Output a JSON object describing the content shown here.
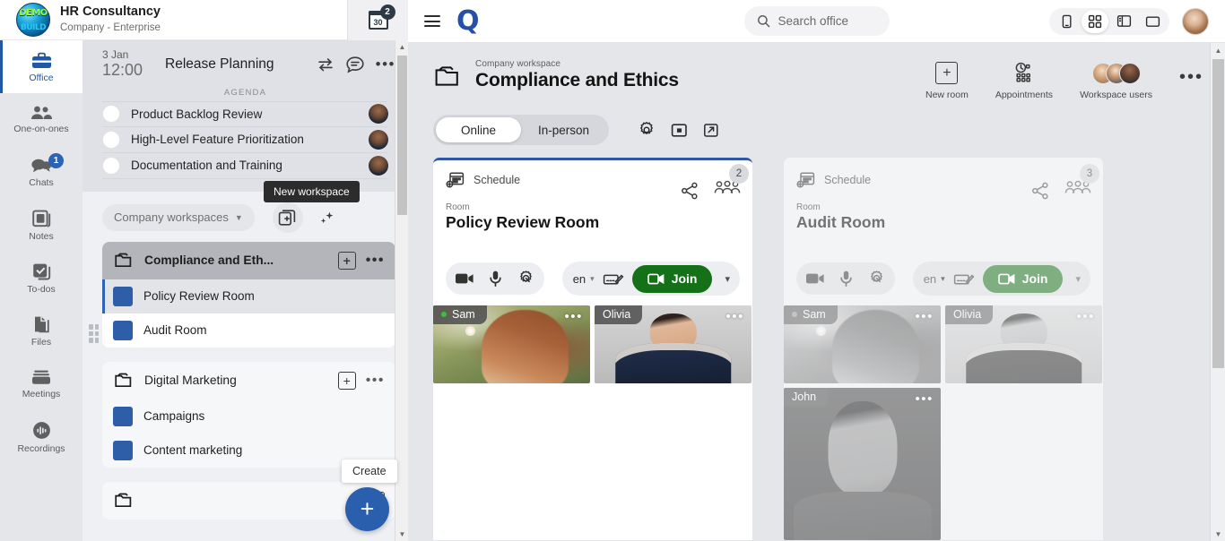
{
  "brand": {
    "title": "HR Consultancy",
    "subtitle": "Company - Enterprise",
    "logo_text_top": "DEMO",
    "logo_text_bottom": "BUILD",
    "calendar_day": "30",
    "calendar_badge": "2"
  },
  "rail": {
    "items": [
      {
        "label": "Office",
        "icon": "briefcase-icon",
        "active": true,
        "badge": ""
      },
      {
        "label": "One-on-ones",
        "icon": "people-icon",
        "active": false,
        "badge": ""
      },
      {
        "label": "Chats",
        "icon": "chat-bubbles-icon",
        "active": false,
        "badge": "1"
      },
      {
        "label": "Notes",
        "icon": "notes-icon",
        "active": false,
        "badge": ""
      },
      {
        "label": "To-dos",
        "icon": "checkbox-stack-icon",
        "active": false,
        "badge": ""
      },
      {
        "label": "Files",
        "icon": "files-icon",
        "active": false,
        "badge": ""
      },
      {
        "label": "Meetings",
        "icon": "meetings-icon",
        "active": false,
        "badge": ""
      },
      {
        "label": "Recordings",
        "icon": "recordings-icon",
        "active": false,
        "badge": ""
      }
    ]
  },
  "agenda": {
    "date": "3 Jan",
    "time": "12:00",
    "title": "Release Planning",
    "section_label": "AGENDA",
    "items": [
      {
        "text": "Product Backlog Review"
      },
      {
        "text": "High-Level Feature Prioritization"
      },
      {
        "text": "Documentation and Training"
      }
    ]
  },
  "workspaces_panel": {
    "selector_label": "Company workspaces",
    "new_workspace_tooltip": "New workspace",
    "create_tooltip": "Create",
    "groups": [
      {
        "name": "Compliance and Eth...",
        "selected": true,
        "rooms": [
          {
            "name": "Policy Review Room",
            "active": true
          },
          {
            "name": "Audit Room",
            "active": false
          }
        ]
      },
      {
        "name": "Digital Marketing",
        "selected": false,
        "rooms": [
          {
            "name": "Campaigns",
            "active": false
          },
          {
            "name": "Content marketing",
            "active": false
          }
        ]
      }
    ]
  },
  "topbar": {
    "logo": "Q",
    "search_placeholder": "Search office",
    "view_modes": [
      {
        "name": "mobile-view",
        "active": false
      },
      {
        "name": "grid-view",
        "active": true
      },
      {
        "name": "split-view",
        "active": false
      },
      {
        "name": "single-view",
        "active": false
      }
    ]
  },
  "workspace": {
    "eyebrow": "Company workspace",
    "title": "Compliance and Ethics",
    "actions": [
      {
        "label": "New room",
        "icon": "plus-square-icon"
      },
      {
        "label": "Appointments",
        "icon": "appointments-icon"
      },
      {
        "label": "Workspace users",
        "icon": "avatar-stack-icon"
      }
    ],
    "tabs": [
      {
        "label": "Online",
        "active": true
      },
      {
        "label": "In-person",
        "active": false
      }
    ],
    "tab_icons": [
      {
        "name": "settings-gear-icon"
      },
      {
        "name": "picture-in-picture-icon"
      },
      {
        "name": "open-external-icon"
      }
    ]
  },
  "rooms": [
    {
      "schedule_label": "Schedule",
      "room_label": "Room",
      "name": "Policy Review Room",
      "participant_count": "2",
      "language": "en",
      "join_label": "Join",
      "active": true,
      "tiles": [
        {
          "name": "Sam",
          "online": true,
          "tall": false,
          "photo": "ph-sam"
        },
        {
          "name": "Olivia",
          "online": false,
          "tall": false,
          "photo": "ph-olivia"
        }
      ]
    },
    {
      "schedule_label": "Schedule",
      "room_label": "Room",
      "name": "Audit Room",
      "participant_count": "3",
      "language": "en",
      "join_label": "Join",
      "active": false,
      "tiles": [
        {
          "name": "Sam",
          "online": true,
          "tall": false,
          "photo": "ph-sam"
        },
        {
          "name": "Olivia",
          "online": false,
          "tall": false,
          "photo": "ph-olivia"
        },
        {
          "name": "John",
          "online": false,
          "tall": true,
          "photo": "ph-john"
        }
      ]
    }
  ],
  "colors": {
    "accent_blue": "#2450a8",
    "join_green": "#147118",
    "badge_blue": "#2b64b4",
    "panel_bg": "#e4e6ea"
  }
}
